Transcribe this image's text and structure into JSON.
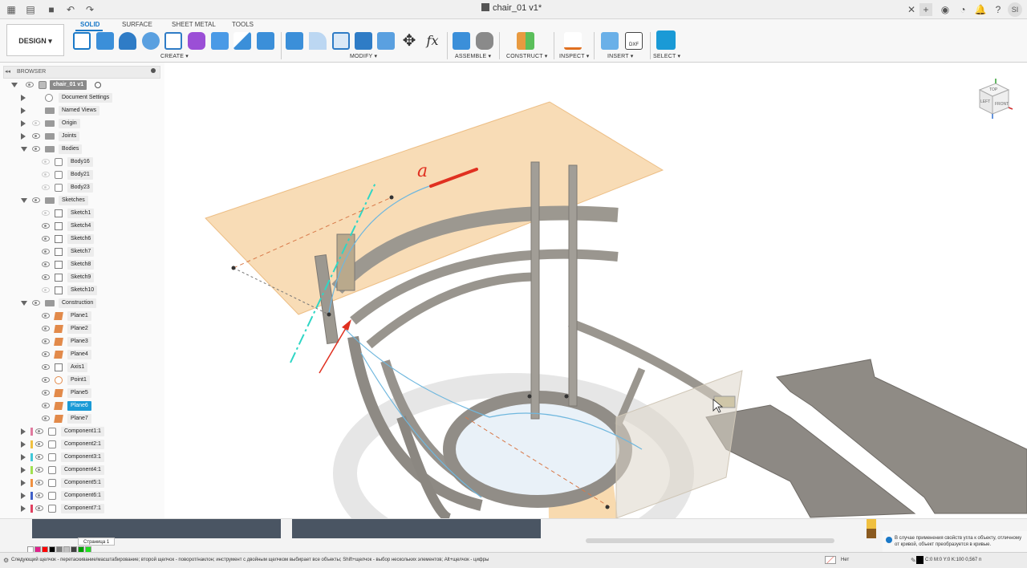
{
  "window": {
    "title": "chair_01 v1*",
    "user_initials": "SI"
  },
  "toolbar": {
    "workspace_button": "DESIGN ▾",
    "tabs": [
      "SOLID",
      "SURFACE",
      "SHEET METAL",
      "TOOLS"
    ],
    "active_tab": "SOLID",
    "groups": {
      "create": "CREATE ▾",
      "modify": "MODIFY ▾",
      "assemble": "ASSEMBLE ▾",
      "construct": "CONSTRUCT ▾",
      "inspect": "INSPECT ▾",
      "insert": "INSERT ▾",
      "select": "SELECT ▾"
    },
    "accent_color": "#1a79c8"
  },
  "browser": {
    "header": "BROWSER",
    "root": "chair_01 v1",
    "items": {
      "document_settings": "Document Settings",
      "named_views": "Named Views",
      "origin": "Origin",
      "joints": "Joints",
      "bodies": "Bodies",
      "body16": "Body16",
      "body21": "Body21",
      "body23": "Body23",
      "sketches": "Sketches",
      "sketch1": "Sketch1",
      "sketch4": "Sketch4",
      "sketch6": "Sketch6",
      "sketch7": "Sketch7",
      "sketch8": "Sketch8",
      "sketch9": "Sketch9",
      "sketch10": "Sketch10",
      "construction": "Construction",
      "plane1": "Plane1",
      "plane2": "Plane2",
      "plane3": "Plane3",
      "plane4": "Plane4",
      "axis1": "Axis1",
      "point1": "Point1",
      "plane5": "Plane5",
      "plane6": "Plane6",
      "plane7": "Plane7",
      "component1": "Component1:1",
      "component2": "Component2:1",
      "component3": "Component3:1",
      "component4": "Component4:1",
      "component5": "Component5:1",
      "component6": "Component6:1",
      "component7": "Component7:1"
    },
    "selected_item": "Plane6",
    "component_colors": [
      "#e07a9e",
      "#f0c040",
      "#40c8d8",
      "#a0e050",
      "#f09040",
      "#4060c8",
      "#e04060"
    ]
  },
  "viewport": {
    "annotation": "a",
    "viewcube": {
      "top": "TOP",
      "front": "FRONT",
      "left": "LEFT"
    }
  },
  "bottom": {
    "page_tab": "Страница 1",
    "hint": "В случае применения свойств угла к объекту, отличному от кривой, объект преобразуется в кривые.",
    "status": "Следующий щелчок - перетаскивание/масштабирование; второй щелчок - поворот/наклон; инструмент с двойным щелчком выбирает все объекты; Shift+щелчок - выбор нескольких элементов; Alt+щелчок - цифры",
    "fill_label": "Нет",
    "color_readout": "C:0 M:0 Y:0 K:100  0,567 п",
    "palette": [
      "#ffffff",
      "#e0208a",
      "#ff0000",
      "#000000",
      "#7f7f7f",
      "#c0c0c0",
      "#404040",
      "#00a000",
      "#20e020"
    ]
  }
}
